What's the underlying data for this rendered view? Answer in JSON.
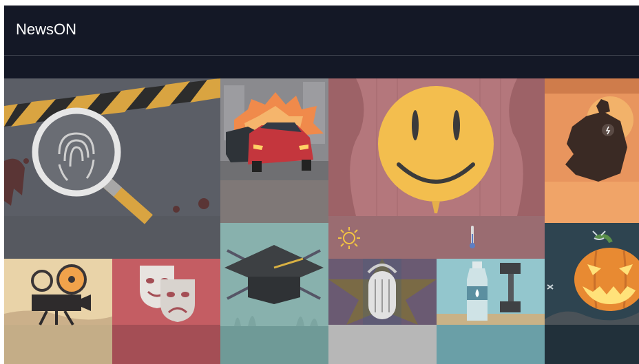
{
  "app": {
    "title": "NewsON"
  },
  "colors": {
    "title_bar": "#141826",
    "crime_bg": "#5b5e66",
    "cars_bottom": "#7f7877",
    "smiley_curtain": "#b4777c",
    "weather_strip": "#9a6c71",
    "superhero_bg": "#e8955e",
    "graduation_bg": "#6f9a97",
    "film_bg": "#c4ad87",
    "theater_bg": "#a44e55",
    "podcast_bg": "#b7b7b7",
    "fitness_bg": "#6a9fa7",
    "halloween_bg": "#21303a"
  },
  "tiles": [
    {
      "icon": "magnifying-glass-fingerprint-icon"
    },
    {
      "icon": "car-crash-icon"
    },
    {
      "icon": "smiley-face-icon"
    },
    {
      "icon": "superhero-silhouette-icon"
    },
    {
      "icon": "graduation-cap-icon"
    },
    {
      "icon": "film-camera-icon"
    },
    {
      "icon": "theater-masks-icon"
    },
    {
      "icon": "microphone-icon"
    },
    {
      "icon": "water-bottle-dumbbell-icon"
    },
    {
      "icon": "jack-o-lantern-icon"
    }
  ],
  "weather": {
    "icons": [
      "sun-icon",
      "thermometer-icon"
    ]
  }
}
